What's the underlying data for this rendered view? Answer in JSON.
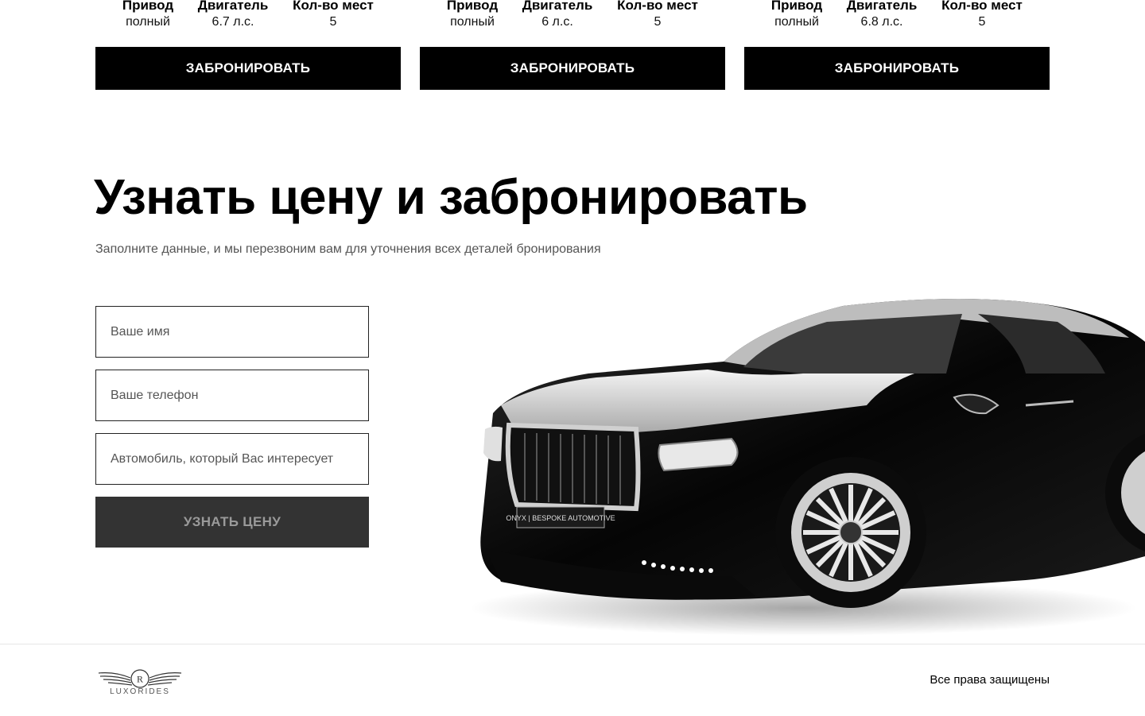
{
  "cards": [
    {
      "specs": [
        {
          "label": "Привод",
          "value": "полный"
        },
        {
          "label": "Двигатель",
          "value": "6.7 л.с."
        },
        {
          "label": "Кол-во мест",
          "value": "5"
        }
      ],
      "button": "ЗАБРОНИРОВАТЬ"
    },
    {
      "specs": [
        {
          "label": "Привод",
          "value": "полный"
        },
        {
          "label": "Двигатель",
          "value": "6 л.с."
        },
        {
          "label": "Кол-во мест",
          "value": "5"
        }
      ],
      "button": "ЗАБРОНИРОВАТЬ"
    },
    {
      "specs": [
        {
          "label": "Привод",
          "value": "полный"
        },
        {
          "label": "Двигатель",
          "value": "6.8 л.с."
        },
        {
          "label": "Кол-во мест",
          "value": "5"
        }
      ],
      "button": "ЗАБРОНИРОВАТЬ"
    }
  ],
  "booking": {
    "title": "Узнать цену и забронировать",
    "subtitle": "Заполните данные, и мы перезвоним вам для уточнения всех деталей бронирования",
    "name_placeholder": "Ваше имя",
    "phone_placeholder": "Ваше телефон",
    "car_placeholder": "Автомобиль, который Вас интересует",
    "submit_label": "УЗНАТЬ ЦЕНУ",
    "car_plate": "ONYX | BESPOKE AUTOMOTIVE"
  },
  "footer": {
    "logo_text": "LUXORIDES",
    "logo_letter": "R",
    "rights": "Все права защищены"
  }
}
